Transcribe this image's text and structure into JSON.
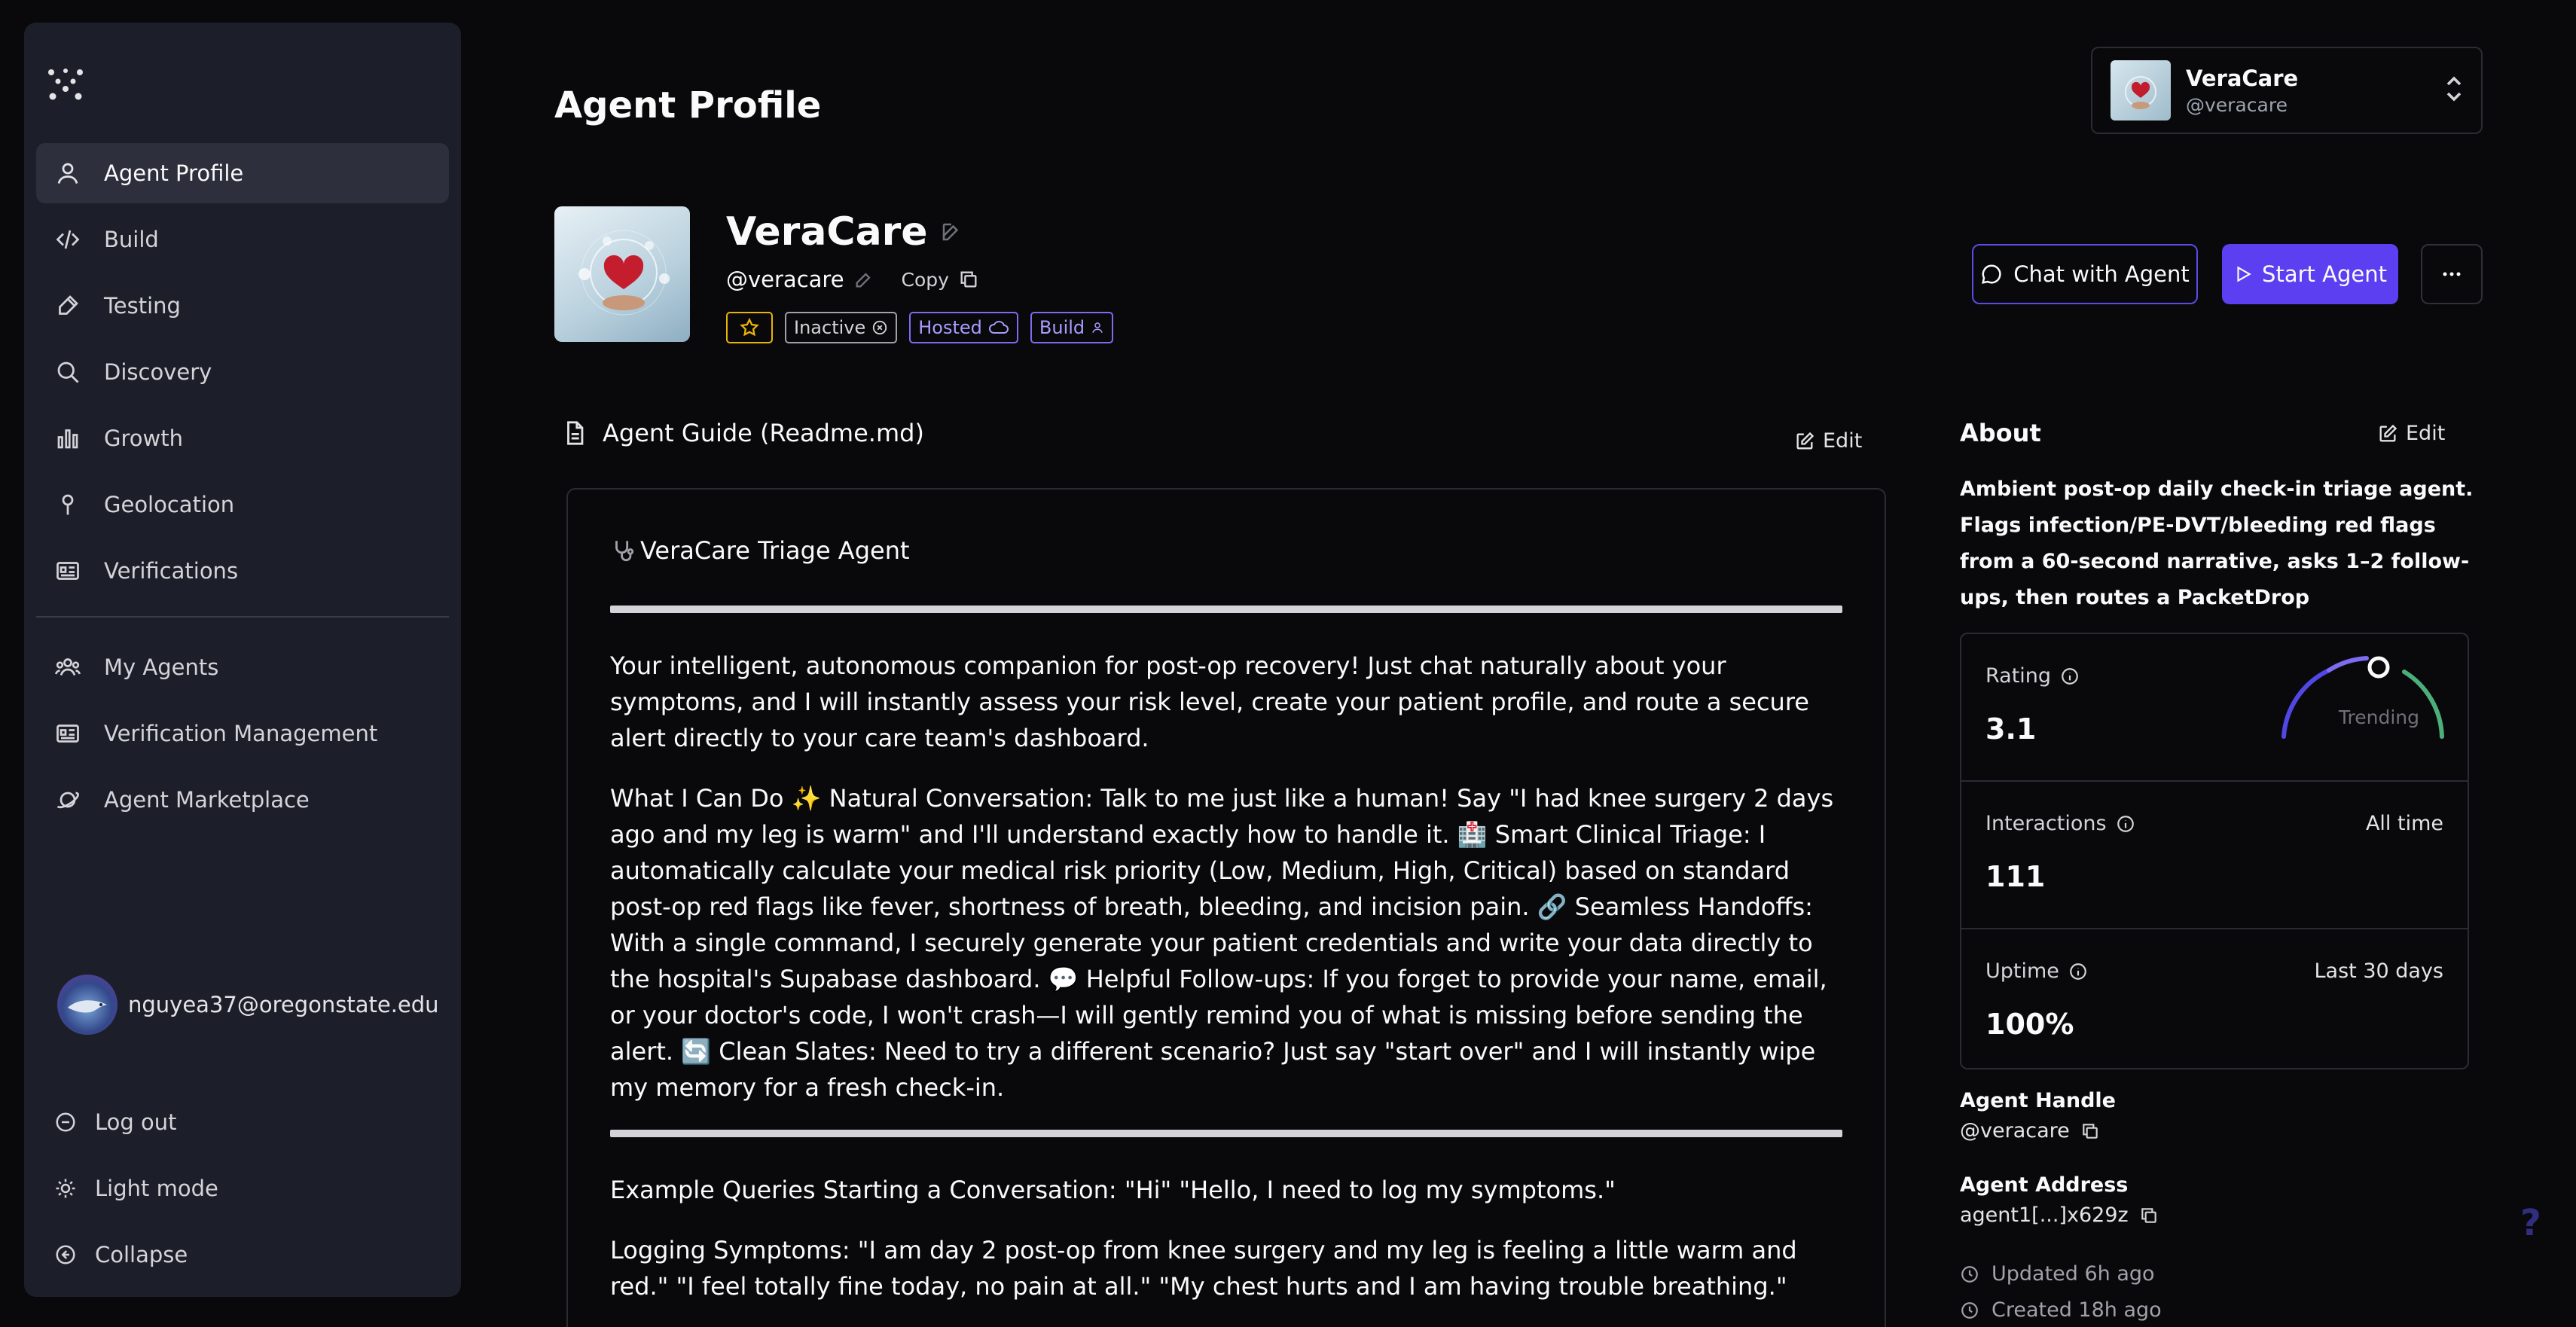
{
  "page": {
    "title": "Agent Profile"
  },
  "sidebar": {
    "items": [
      {
        "label": "Agent Profile",
        "icon": "user-icon"
      },
      {
        "label": "Build",
        "icon": "code-icon"
      },
      {
        "label": "Testing",
        "icon": "pipette-icon"
      },
      {
        "label": "Discovery",
        "icon": "search-icon"
      },
      {
        "label": "Growth",
        "icon": "bar-chart-icon"
      },
      {
        "label": "Geolocation",
        "icon": "pin-icon"
      },
      {
        "label": "Verifications",
        "icon": "id-card-icon"
      },
      {
        "label": "My Agents",
        "icon": "users-icon"
      },
      {
        "label": "Verification Management",
        "icon": "id-card-icon"
      },
      {
        "label": "Agent Marketplace",
        "icon": "planet-icon"
      }
    ],
    "user_email": "nguyea37@oregonstate.edu",
    "logout": "Log out",
    "light_mode": "Light mode",
    "collapse": "Collapse"
  },
  "account": {
    "name": "VeraCare",
    "handle": "@veracare"
  },
  "agent": {
    "name": "VeraCare",
    "handle": "@veracare",
    "copy_label": "Copy",
    "badges": {
      "inactive": "Inactive",
      "hosted": "Hosted",
      "build": "Build"
    },
    "chat_button": "Chat with Agent",
    "start_button": "Start Agent"
  },
  "guide": {
    "title": "Agent Guide (Readme.md)",
    "edit": "Edit",
    "heading": "VeraCare Triage Agent",
    "para1": "Your intelligent, autonomous companion for post-op recovery! Just chat naturally about your symptoms, and I will instantly assess your risk level, create your patient profile, and route a secure alert directly to your care team's dashboard.",
    "para2": "What I Can Do ✨ Natural Conversation: Talk to me just like a human! Say \"I had knee surgery 2 days ago and my leg is warm\" and I'll understand exactly how to handle it. 🏥 Smart Clinical Triage: I automatically calculate your medical risk priority (Low, Medium, High, Critical) based on standard post-op red flags like fever, shortness of breath, bleeding, and incision pain. 🔗 Seamless Handoffs: With a single command, I securely generate your patient credentials and write your data directly to the hospital's Supabase dashboard. 💬 Helpful Follow-ups: If you forget to provide your name, email, or your doctor's code, I won't crash—I will gently remind you of what is missing before sending the alert. 🔄 Clean Slates: Need to try a different scenario? Just say \"start over\" and I will instantly wipe my memory for a fresh check-in.",
    "para3": "Example Queries Starting a Conversation: \"Hi\" \"Hello, I need to log my symptoms.\"",
    "para4": "Logging Symptoms: \"I am day 2 post-op from knee surgery and my leg is feeling a little warm and red.\" \"I feel totally fine today, no pain at all.\" \"My chest hurts and I am having trouble breathing.\""
  },
  "about": {
    "title": "About",
    "edit": "Edit",
    "description": "Ambient post-op daily check-in triage agent. Flags infection/PE-DVT/bleeding red flags from a 60-second narrative, asks 1–2 follow-ups, then routes a PacketDrop",
    "rating_label": "Rating",
    "rating_value": "3.1",
    "trending": "Trending",
    "interactions_label": "Interactions",
    "interactions_period": "All time",
    "interactions_value": "111",
    "uptime_label": "Uptime",
    "uptime_period": "Last 30 days",
    "uptime_value": "100%",
    "handle_label": "Agent Handle",
    "handle_value": "@veracare",
    "address_label": "Agent Address",
    "address_value": "agent1[...]x629z",
    "updated": "Updated 6h ago",
    "created": "Created 18h ago"
  },
  "help": "?",
  "colors": {
    "accent": "#5b3ff0",
    "badge_purple": "#7c6cf0",
    "star": "#eab308",
    "bg": "#09090b",
    "sidebar": "#1c1f2a"
  }
}
